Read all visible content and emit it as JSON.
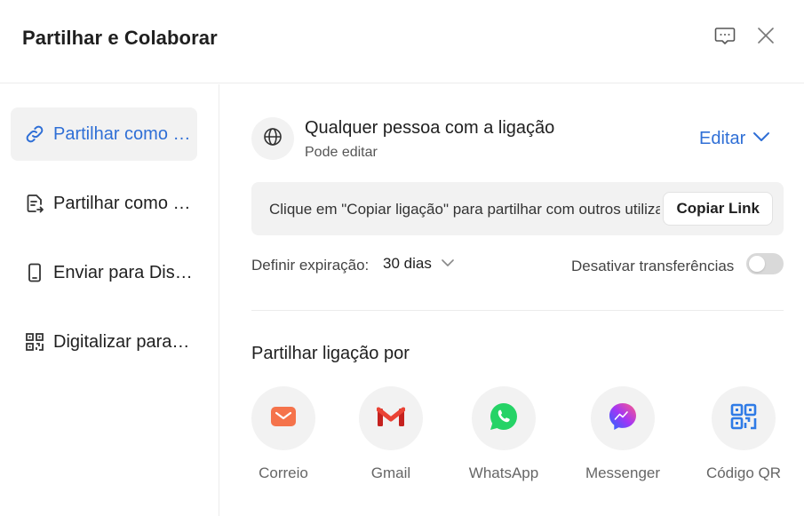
{
  "header": {
    "title": "Partilhar e Colaborar",
    "feedback_icon": "feedback-chat-icon",
    "close_icon": "close-icon"
  },
  "sidebar": {
    "items": [
      {
        "label": "Partilhar como link",
        "icon": "link-icon",
        "active": true
      },
      {
        "label": "Partilhar como ficheiro",
        "icon": "file-share-icon",
        "active": false
      },
      {
        "label": "Enviar para Dispositivo",
        "icon": "phone-icon",
        "active": false
      },
      {
        "label": "Digitalizar para partilhar",
        "icon": "qr-code-icon",
        "active": false
      }
    ]
  },
  "access": {
    "icon": "globe-icon",
    "title": "Qualquer pessoa com a ligação",
    "subtitle": "Pode editar",
    "edit_label": "Editar"
  },
  "link_box": {
    "text": "Clique em \"Copiar ligação\" para partilhar com outros utilizadores",
    "copy_label": "Copiar Link"
  },
  "expiration": {
    "label": "Definir expiração:",
    "value": "30 dias"
  },
  "downloads": {
    "label": "Desativar transferências",
    "enabled": false
  },
  "share_via": {
    "title": "Partilhar ligação por",
    "options": [
      {
        "label": "Correio",
        "icon": "mail-icon",
        "color": "#f5734b"
      },
      {
        "label": "Gmail",
        "icon": "gmail-icon",
        "color": "#ea4335"
      },
      {
        "label": "WhatsApp",
        "icon": "whatsapp-icon",
        "color": "#25d366"
      },
      {
        "label": "Messenger",
        "icon": "messenger-icon",
        "color": "#8b3cf7"
      },
      {
        "label": "Código QR",
        "icon": "qr-code-icon",
        "color": "#2f7be6"
      }
    ]
  },
  "colors": {
    "accent": "#2f6fd6",
    "panel_bg": "#f2f2f2"
  }
}
